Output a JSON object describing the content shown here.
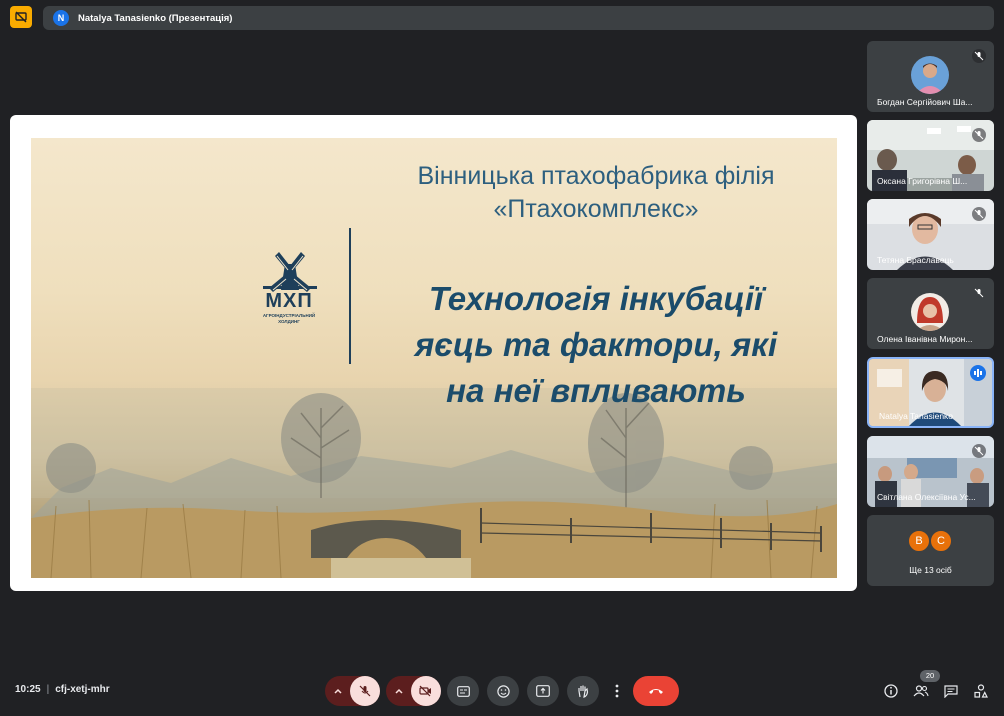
{
  "header": {
    "presenter_initial": "N",
    "title": "Natalya Tanasienko (Презентація)"
  },
  "slide": {
    "header_line1": "Вінницька птахофабрика філія",
    "header_line2": "«Птахокомплекс»",
    "main_line1": "Технологія інкубації",
    "main_line2": "яєць та фактори, які",
    "main_line3": "на неї впливають",
    "logo_name": "МХП",
    "logo_sub_line1": "АГРОІНДУСТРІАЛЬНИЙ",
    "logo_sub_line2": "ХОЛДИНГ"
  },
  "participants": [
    {
      "name": "Богдан Сергійович Ша...",
      "muted": true,
      "kind": "avatar"
    },
    {
      "name": "Оксана Григорівна Ш...",
      "muted": true,
      "kind": "video"
    },
    {
      "name": "Тетяна Браславець",
      "muted": true,
      "kind": "video"
    },
    {
      "name": "Олена Іванівна Мирон...",
      "muted": true,
      "kind": "avatar"
    },
    {
      "name": "Natalya Tanasienko",
      "muted": false,
      "speaking": true,
      "kind": "video"
    },
    {
      "name": "Світлана Олексіївна Ус...",
      "muted": true,
      "kind": "video"
    }
  ],
  "more": {
    "initials": [
      "B",
      "C"
    ],
    "colors": [
      "#e8710a",
      "#e8710a"
    ],
    "label": "Ще 13 осіб"
  },
  "footer": {
    "time": "10:25",
    "meeting_code": "cfj-xetj-mhr",
    "people_count": "20"
  },
  "colors": {
    "background": "#202124",
    "surface": "#3c4043",
    "accent": "#8ab4f8",
    "hangup": "#ea4335",
    "present_indicator": "#f9ab00"
  }
}
